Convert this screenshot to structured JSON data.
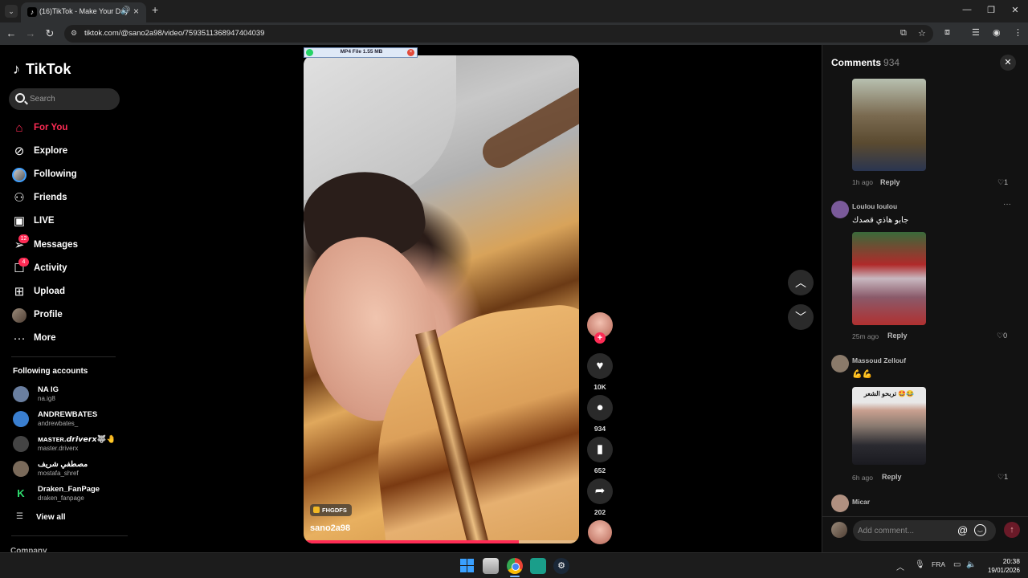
{
  "browser": {
    "tab_title": "(16)TikTok - Make Your Day",
    "url": "tiktok.com/@sano2a98/video/7593511368947404039",
    "icons": [
      "tab-dropdown-icon",
      "tiktok-favicon",
      "speaker-icon",
      "close-icon",
      "plus-icon",
      "minimize-icon",
      "restore-icon",
      "close-window-icon",
      "back-icon",
      "forward-icon",
      "reload-icon",
      "site-info-icon",
      "install-app-icon",
      "star-icon",
      "extensions-icon",
      "reading-list-icon",
      "profile-icon",
      "menu-icon"
    ]
  },
  "download_bar": {
    "label": "MP4 File 1.55 MB"
  },
  "sidebar": {
    "logo": "TikTok",
    "search_placeholder": "Search",
    "nav": [
      {
        "label": "For You",
        "icon": "home-icon",
        "active": true
      },
      {
        "label": "Explore",
        "icon": "compass-icon"
      },
      {
        "label": "Following",
        "icon": "following-avatar"
      },
      {
        "label": "Friends",
        "icon": "friends-icon"
      },
      {
        "label": "LIVE",
        "icon": "live-icon"
      },
      {
        "label": "Messages",
        "icon": "messages-icon",
        "badge": "12"
      },
      {
        "label": "Activity",
        "icon": "activity-icon",
        "badge": "4"
      },
      {
        "label": "Upload",
        "icon": "upload-icon"
      },
      {
        "label": "Profile",
        "icon": "profile-avatar"
      },
      {
        "label": "More",
        "icon": "more-icon"
      }
    ],
    "following_title": "Following accounts",
    "accounts": [
      {
        "name": "NA IG",
        "handle": "na.ig8",
        "color": "#6a7fa0"
      },
      {
        "name": "ANDREWBATES",
        "handle": "andrewbates_",
        "color": "#3a7fd0"
      },
      {
        "name": "ᴍᴀsᴛᴇʀ.𝙙𝙧𝙞𝙫𝙚𝙧𝙭🐺🤚",
        "handle": "master.driverx",
        "color": "#444"
      },
      {
        "name": "مصطفي شريف",
        "handle": "mostafa_shref",
        "color": "#7a6a5a"
      },
      {
        "name": "Draken_FanPage",
        "handle": "draken_fanpage",
        "color": "#000"
      }
    ],
    "view_all": "View all",
    "company": "Company"
  },
  "video": {
    "tag": "FHGDFS",
    "author": "sano2a98",
    "progress": 0.78
  },
  "actions": {
    "likes": "10K",
    "comments": "934",
    "saves": "652",
    "shares": "202"
  },
  "comments": {
    "title": "Comments",
    "count": "934",
    "items": [
      {
        "user": "",
        "text": "",
        "time": "1h ago",
        "reply": "Reply",
        "likes": "1"
      },
      {
        "user": "Loulou loulou",
        "text": "جابو هاذي قصدك",
        "time": "25m ago",
        "reply": "Reply",
        "likes": "0"
      },
      {
        "user": "Massoud Zellouf",
        "text": "💪💪",
        "image_caption": "تربحو الشعر 🤩😂",
        "time": "6h ago",
        "reply": "Reply",
        "likes": "1"
      },
      {
        "user": "Micar"
      }
    ],
    "input_placeholder": "Add comment...",
    "more": "···"
  },
  "taskbar": {
    "lang": "FRA",
    "time": "20:38",
    "date": "19/01/2026"
  },
  "colors": {
    "accent": "#fe2c55",
    "background": "#000000",
    "panel": "#121212"
  }
}
